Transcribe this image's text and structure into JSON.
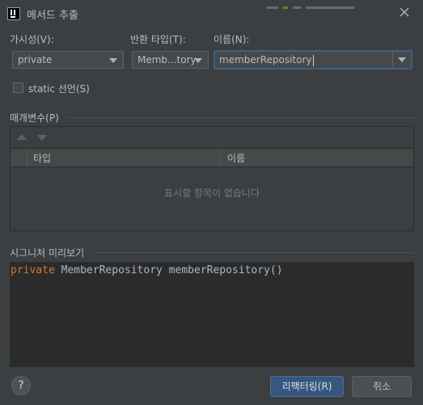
{
  "window": {
    "title": "메서드 추출"
  },
  "form": {
    "visibility": {
      "label": "가시성(V):",
      "value": "private"
    },
    "return_type": {
      "label": "반환 타입(T):",
      "value": "Memb...tory"
    },
    "name": {
      "label": "이름(N):",
      "value": "memberRepository"
    },
    "static_checkbox": {
      "label": "static 선언(S)",
      "checked": false
    }
  },
  "parameters": {
    "section_label": "매개변수(P)",
    "columns": [
      "타입",
      "이름"
    ],
    "empty_text": "표시할 항목이 없습니다"
  },
  "signature": {
    "section_label": "시그니처 미리보기",
    "keyword": "private",
    "rest": " MemberRepository memberRepository()"
  },
  "buttons": {
    "help": "?",
    "refactor": "리팩터링(R)",
    "cancel": "취소"
  },
  "icons": {
    "app": "intellij-app-icon",
    "close": "close-icon",
    "combo_arrow": "chevron-down-icon",
    "move_up": "arrow-up-icon",
    "move_down": "arrow-down-icon",
    "help": "help-icon"
  },
  "colors": {
    "background": "#3c3f41",
    "code_background": "#2b2b2b",
    "keyword": "#cc7832",
    "code_text": "#a9b7c6",
    "focus_border": "#3d6185",
    "primary_button": "#365880"
  }
}
